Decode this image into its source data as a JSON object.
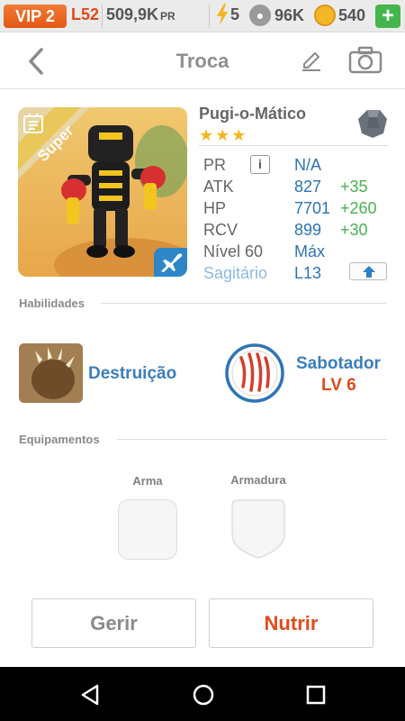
{
  "status_bar": {
    "vip": "VIP 2",
    "level": "L52",
    "power": "509,9K",
    "power_unit": "PR",
    "energy": "5",
    "food": "96K",
    "coins": "540",
    "add_label": "+"
  },
  "header": {
    "title": "Troca"
  },
  "pet": {
    "name": "Pugi-o-Mático",
    "rank_label": "Super",
    "stars": "★★★",
    "stats": [
      {
        "label": "PR",
        "value": "N/A",
        "bonus": ""
      },
      {
        "label": "ATK",
        "value": "827",
        "bonus": "+35"
      },
      {
        "label": "HP",
        "value": "7701",
        "bonus": "+260"
      },
      {
        "label": "RCV",
        "value": "899",
        "bonus": "+30"
      },
      {
        "label": "Nível 60",
        "value": "Máx",
        "bonus": ""
      },
      {
        "label": "Sagitário",
        "value": "L13",
        "bonus": ""
      }
    ]
  },
  "abilities": {
    "section_label": "Habilidades",
    "items": [
      {
        "name": "Destruição",
        "level": ""
      },
      {
        "name": "Sabotador",
        "level": "LV 6"
      }
    ]
  },
  "equipment": {
    "section_label": "Equipamentos",
    "slots": [
      {
        "label": "Arma"
      },
      {
        "label": "Armadura"
      }
    ]
  },
  "actions": {
    "manage": "Gerir",
    "feed": "Nutrir"
  },
  "colors": {
    "accent_orange": "#e04b1c",
    "accent_blue": "#2d73b5",
    "bonus_green": "#4ab050"
  }
}
